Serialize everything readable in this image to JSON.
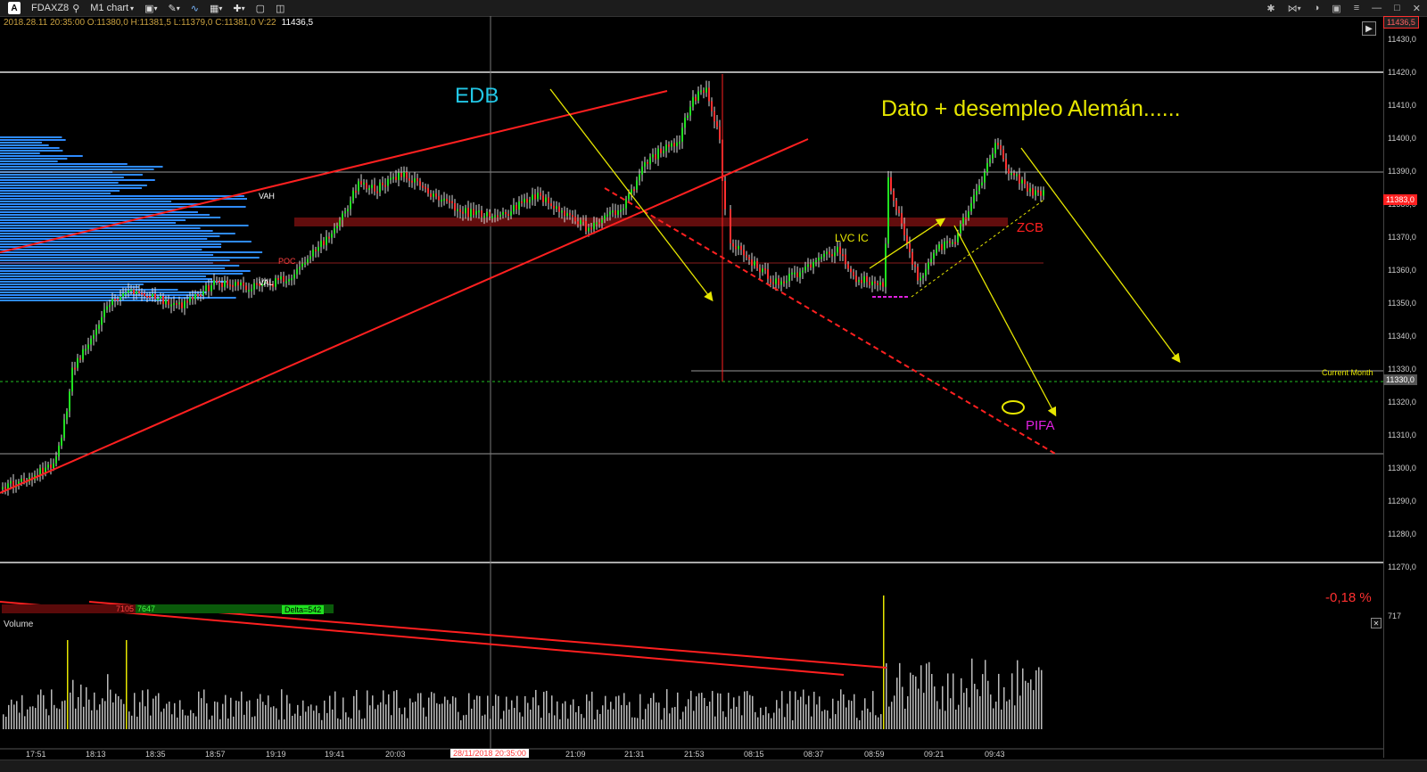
{
  "toolbar": {
    "symbol": "FDAXZ8",
    "chart_type": "M1 chart",
    "logo": "A"
  },
  "ohlc": {
    "text": "2018.28.11 20:35:00   O:11380,0   H:11381,5   L:11379,0   C:11381,0   V:22",
    "last": "11436,5"
  },
  "price_axis": {
    "labels": [
      "11430,0",
      "11420,0",
      "11410,0",
      "11400,0",
      "11390,0",
      "11380,0",
      "11370,0",
      "11360,0",
      "11350,0",
      "11340,0",
      "11330,0",
      "11320,0",
      "11310,0",
      "11300,0",
      "11290,0",
      "11280,0",
      "11270,0"
    ],
    "current_tag": "11383,0",
    "top_tag": "11436,5",
    "level_tag": "11330,0"
  },
  "volume_axis": {
    "top": "717"
  },
  "time_axis": {
    "labels": [
      "17:51",
      "18:13",
      "18:35",
      "18:57",
      "19:19",
      "19:41",
      "20:03",
      "21:09",
      "21:31",
      "21:53",
      "08:15",
      "08:37",
      "08:59",
      "09:21",
      "09:43"
    ],
    "cursor": "28/11/2018 20:35:00"
  },
  "annotations": {
    "edb": "EDB",
    "dato": "Dato + desempleo Alemán......",
    "zcb": "ZCB",
    "lvc": "LVC IC",
    "pifa": "PIFA",
    "pct": "-0,18 %",
    "current_month": "Current Month",
    "vah": "VAH",
    "poc": "POC",
    "val": "VAL"
  },
  "volume_panel": {
    "title": "Volume",
    "sell": "7105",
    "buy": "7647",
    "delta": "Delta=542"
  },
  "colors": {
    "profile": "#2e8bff",
    "trend": "#ff2020",
    "arrow": "#e6e600",
    "edb": "#22c7e6",
    "pifa": "#e020e0",
    "candle_up": "#20e020",
    "candle_down": "#ff3030"
  }
}
